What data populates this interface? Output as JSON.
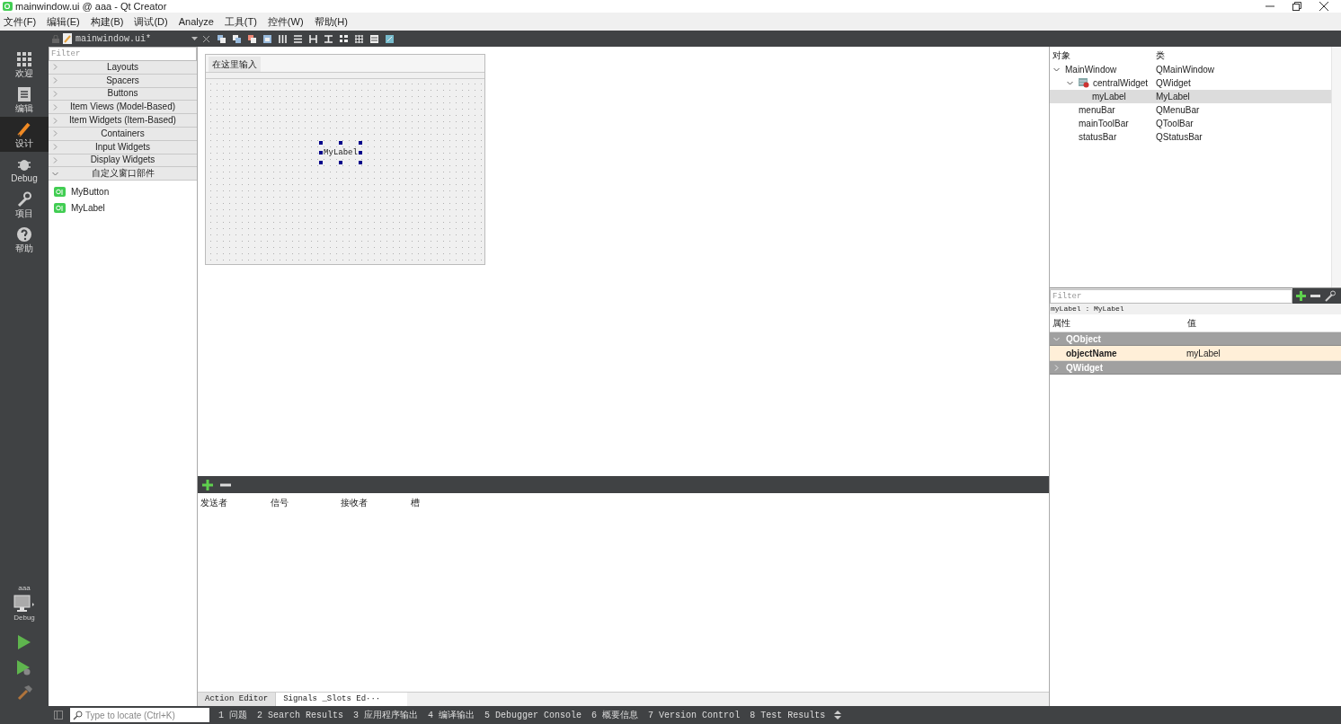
{
  "window": {
    "title": "mainwindow.ui @ aaa - Qt Creator"
  },
  "menu": [
    "文件(F)",
    "编辑(E)",
    "构建(B)",
    "调试(D)",
    "Analyze",
    "工具(T)",
    "控件(W)",
    "帮助(H)"
  ],
  "editor_tab": {
    "label": "mainwindow.ui*"
  },
  "mode_bar": [
    {
      "label": "欢迎",
      "kind": "grid",
      "selected": false
    },
    {
      "label": "编辑",
      "kind": "document",
      "selected": false
    },
    {
      "label": "设计",
      "kind": "pencil",
      "selected": true
    },
    {
      "label": "Debug",
      "kind": "bug",
      "selected": false
    },
    {
      "label": "项目",
      "kind": "wrench",
      "selected": false
    },
    {
      "label": "帮助",
      "kind": "help",
      "selected": false
    }
  ],
  "kit": {
    "project": "aaa",
    "build": "Debug"
  },
  "widget_box": {
    "filter_placeholder": "Filter",
    "categories": [
      {
        "label": "Layouts",
        "expanded": false
      },
      {
        "label": "Spacers",
        "expanded": false
      },
      {
        "label": "Buttons",
        "expanded": false
      },
      {
        "label": "Item Views (Model-Based)",
        "expanded": false
      },
      {
        "label": "Item Widgets (Item-Based)",
        "expanded": false
      },
      {
        "label": "Containers",
        "expanded": false
      },
      {
        "label": "Input Widgets",
        "expanded": false
      },
      {
        "label": "Display Widgets",
        "expanded": false
      },
      {
        "label": "自定义窗口部件",
        "expanded": true
      }
    ],
    "custom_widgets": [
      "MyButton",
      "MyLabel"
    ]
  },
  "form": {
    "menu_placeholder": "在这里输入",
    "label": "MyLabel"
  },
  "signals_slots": {
    "columns": [
      "发送者",
      "信号",
      "接收者",
      "槽"
    ]
  },
  "bottom_tabs": [
    {
      "label": "Action Editor",
      "selected": false
    },
    {
      "label": "Signals _Slots Ed···",
      "selected": true
    }
  ],
  "object_inspector": {
    "columns": [
      "对象",
      "类"
    ],
    "tree": [
      {
        "name": "MainWindow",
        "class": "QMainWindow",
        "selected": false,
        "expanded": true,
        "children": [
          {
            "name": "centralWidget",
            "class": "QWidget",
            "selected": false,
            "expanded": true,
            "children": [
              {
                "name": "myLabel",
                "class": "MyLabel",
                "selected": true
              }
            ]
          },
          {
            "name": "menuBar",
            "class": "QMenuBar",
            "selected": false
          },
          {
            "name": "mainToolBar",
            "class": "QToolBar",
            "selected": false
          },
          {
            "name": "statusBar",
            "class": "QStatusBar",
            "selected": false
          }
        ]
      }
    ]
  },
  "property_editor": {
    "filter_placeholder": "Filter",
    "object_title": "myLabel : MyLabel",
    "columns": [
      "属性",
      "值"
    ],
    "groups": [
      {
        "label": "QObject",
        "expanded": true,
        "properties": [
          {
            "name": "objectName",
            "value": "myLabel"
          }
        ]
      },
      {
        "label": "QWidget",
        "expanded": false
      }
    ]
  },
  "status_bar": {
    "locator_placeholder": "Type to locate (Ctrl+K)",
    "panes": [
      "1 问题",
      "2 Search Results",
      "3 应用程序输出",
      "4 编译输出",
      "5 Debugger Console",
      "6 概要信息",
      "7 Version Control",
      "8 Test Results"
    ]
  }
}
